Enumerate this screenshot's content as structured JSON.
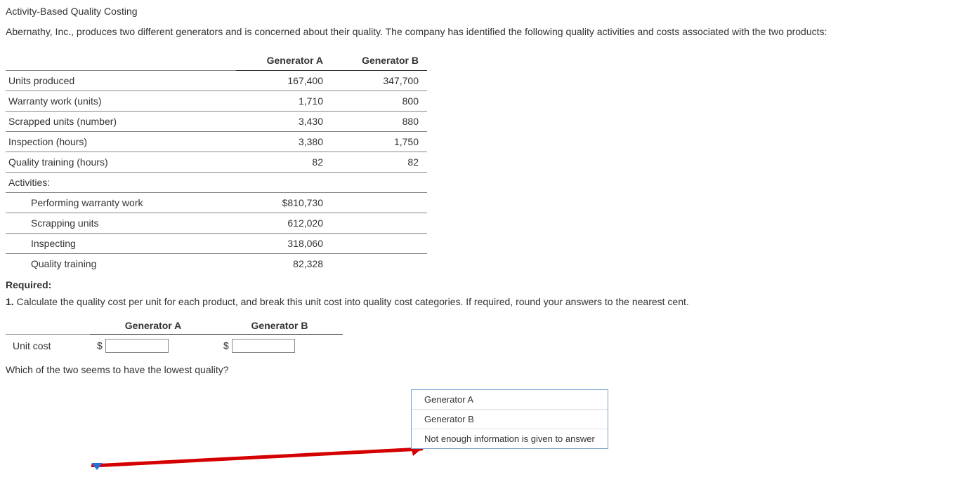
{
  "title": "Activity-Based Quality Costing",
  "intro": "Abernathy, Inc., produces two different generators and is concerned about their quality. The company has identified the following quality activities and costs associated with the two products:",
  "table1": {
    "header_a": "Generator A",
    "header_b": "Generator B",
    "rows": [
      {
        "label": "Units produced",
        "a": "167,400",
        "b": "347,700"
      },
      {
        "label": "Warranty work (units)",
        "a": "1,710",
        "b": "800"
      },
      {
        "label": "Scrapped units (number)",
        "a": "3,430",
        "b": "880"
      },
      {
        "label": "Inspection (hours)",
        "a": "3,380",
        "b": "1,750"
      },
      {
        "label": "Quality training (hours)",
        "a": "82",
        "b": "82"
      }
    ],
    "activities_label": "Activities:",
    "activities": [
      {
        "label": "Performing warranty work",
        "a": "$810,730"
      },
      {
        "label": "Scrapping units",
        "a": "612,020"
      },
      {
        "label": "Inspecting",
        "a": "318,060"
      },
      {
        "label": "Quality training",
        "a": "82,328"
      }
    ]
  },
  "required_label": "Required:",
  "question1_num": "1.",
  "question1_text": " Calculate the quality cost per unit for each product, and break this unit cost into quality cost categories. If required, round your answers to the nearest cent.",
  "table2": {
    "header_a": "Generator A",
    "header_b": "Generator B",
    "row_label": "Unit cost",
    "currency": "$"
  },
  "followup": "Which of the two seems to have the lowest quality?",
  "popup": {
    "options": [
      "Generator A",
      "Generator B",
      "Not enough information is given to answer"
    ]
  }
}
